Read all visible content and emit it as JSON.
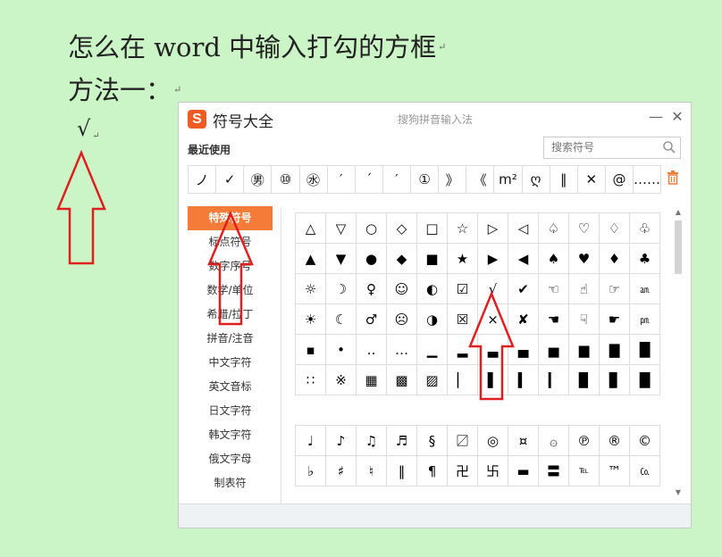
{
  "document": {
    "title_line": "怎么在 word 中输入打勾的方框",
    "method_line": "方法一：",
    "check_line": "√",
    "para_mark": "↵"
  },
  "window": {
    "app_title": "符号大全",
    "ime_name": "搜狗拼音输入法",
    "logo_letter": "S",
    "minimize": "—",
    "close": "✕",
    "recent_label": "最近使用",
    "search_placeholder": "搜索符号",
    "recent_symbols": [
      "ノ",
      "✓",
      "㊚",
      "⑩",
      "㊌",
      "′",
      "´",
      "′",
      "①",
      "》",
      "《",
      "m²",
      "ღ",
      "‖",
      "✕",
      "@",
      "……"
    ]
  },
  "categories": [
    {
      "label": "特殊符号",
      "active": true
    },
    {
      "label": "标点符号",
      "active": false
    },
    {
      "label": "数字序号",
      "active": false
    },
    {
      "label": "数学/单位",
      "active": false
    },
    {
      "label": "希腊/拉丁",
      "active": false
    },
    {
      "label": "拼音/注音",
      "active": false
    },
    {
      "label": "中文字符",
      "active": false
    },
    {
      "label": "英文音标",
      "active": false
    },
    {
      "label": "日文字符",
      "active": false
    },
    {
      "label": "韩文字符",
      "active": false
    },
    {
      "label": "俄文字母",
      "active": false
    },
    {
      "label": "制表符",
      "active": false
    }
  ],
  "grid1": [
    "△",
    "▽",
    "○",
    "◇",
    "□",
    "☆",
    "▷",
    "◁",
    "♤",
    "♡",
    "♢",
    "♧",
    "▲",
    "▼",
    "●",
    "◆",
    "■",
    "★",
    "▶",
    "◀",
    "♠",
    "♥",
    "♦",
    "♣",
    "☼",
    "☽",
    "♀",
    "☺",
    "◐",
    "☑",
    "√",
    "✔",
    "☜",
    "☝",
    "☞",
    "㏂",
    "☀",
    "☾",
    "♂",
    "☹",
    "◑",
    "☒",
    "×",
    "✘",
    "☚",
    "☟",
    "☛",
    "㏘",
    "▪",
    "•",
    "‥",
    "…",
    "▁",
    "▂",
    "▃",
    "▄",
    "▅",
    "▆",
    "▇",
    "█",
    "∷",
    "※",
    "▦",
    "▩",
    "▨",
    "▏",
    "▌",
    "▍",
    "▎",
    "▉",
    "▊",
    "█"
  ],
  "grid2": [
    "♩",
    "♪",
    "♫",
    "♬",
    "§",
    "〼",
    "◎",
    "¤",
    "۞",
    "℗",
    "®",
    "©",
    "♭",
    "♯",
    "♮",
    "‖",
    "¶",
    "卍",
    "卐",
    "▬",
    "〓",
    "℡",
    "™",
    "㏇"
  ],
  "colors": {
    "background": "#cbf5c6",
    "accent": "#f57b38",
    "arrow_red": "#e02020"
  }
}
